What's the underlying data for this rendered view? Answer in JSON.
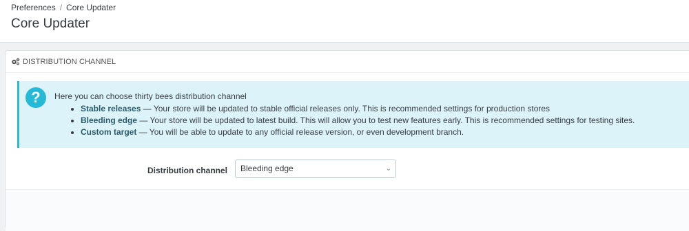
{
  "breadcrumb": {
    "parent": "Preferences",
    "separator": "/",
    "current": "Core Updater"
  },
  "page": {
    "title": "Core Updater"
  },
  "panel": {
    "heading_icon": "cogs-icon",
    "heading": "DISTRIBUTION CHANNEL"
  },
  "info_alert": {
    "icon": "question-icon",
    "icon_glyph": "?",
    "intro": "Here you can choose thirty bees distribution channel",
    "items": [
      {
        "name": "Stable releases",
        "text": " — Your store will be updated to stable official releases only. This is recommended settings for production stores"
      },
      {
        "name": "Bleeding edge",
        "text": " — Your store will be updated to latest build. This will allow you to test new features early. This is recommended settings for testing sites."
      },
      {
        "name": "Custom target",
        "text": " — You will be able to update to any official release version, or even development branch."
      }
    ]
  },
  "form": {
    "channel_label": "Distribution channel",
    "channel_value": "Bleeding edge"
  },
  "colors": {
    "accent": "#25b9d7",
    "alert_bg": "#dcf4f9"
  }
}
